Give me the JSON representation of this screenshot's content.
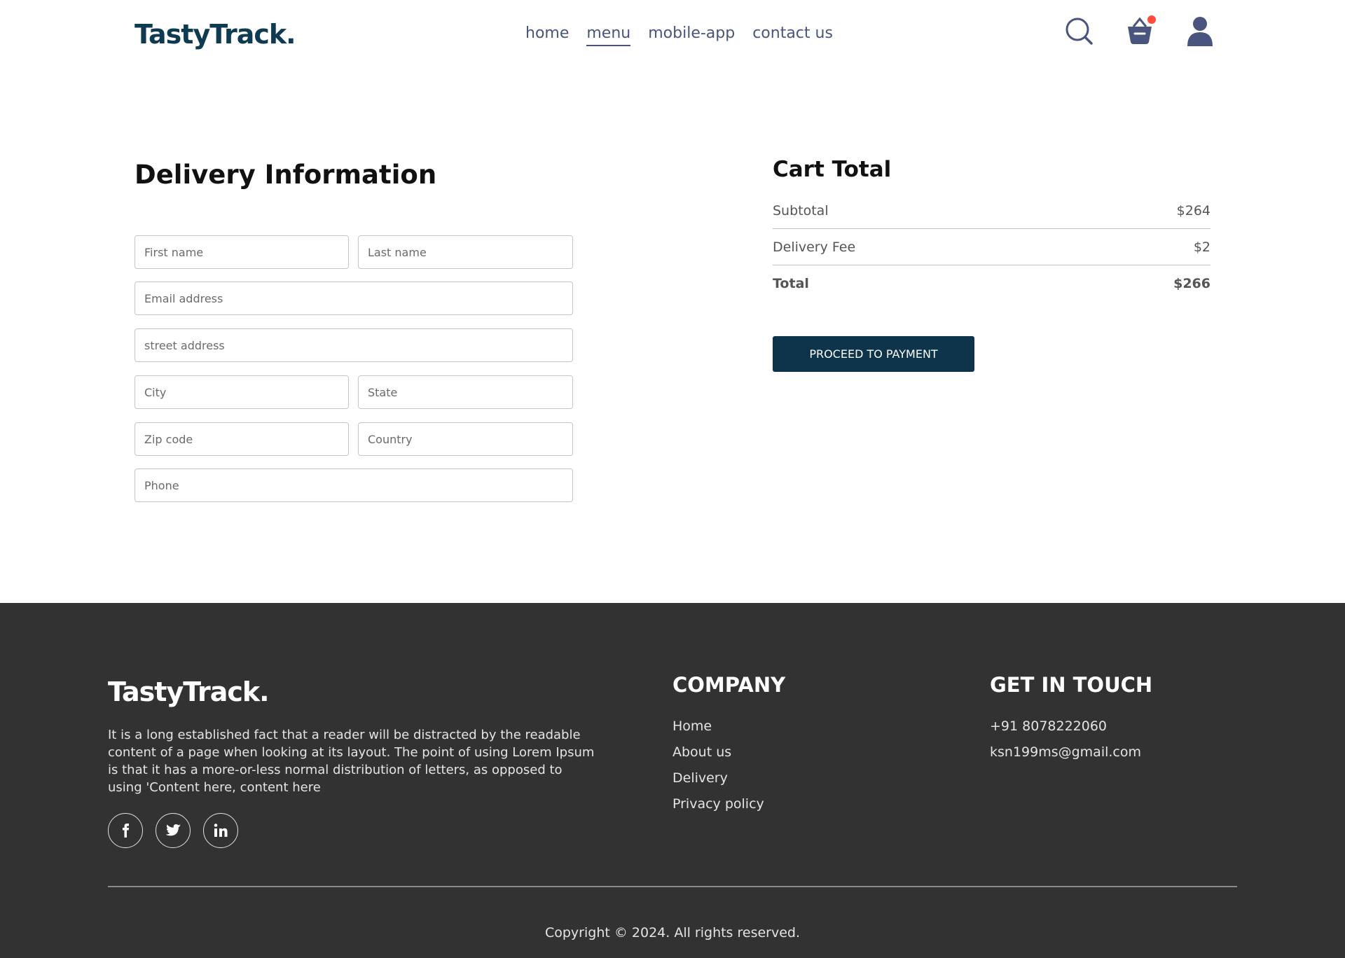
{
  "navbar": {
    "logo": "TastyTrack.",
    "menu": [
      "home",
      "menu",
      "mobile-app",
      "contact us"
    ],
    "active_menu": "menu",
    "icons": [
      "search-icon",
      "basket-icon",
      "profile-icon"
    ],
    "basket_badge_color": "#ff4d3d"
  },
  "delivery": {
    "title": "Delivery Information",
    "fields": {
      "first_name": "First name",
      "last_name": "Last name",
      "email": "Email address",
      "street": "street address",
      "city": "City",
      "state": "State",
      "zip": "Zip code",
      "country": "Country",
      "phone": "Phone"
    }
  },
  "cart": {
    "title": "Cart Total",
    "subtotal_label": "Subtotal",
    "subtotal_value": "$264",
    "fee_label": "Delivery Fee",
    "fee_value": "$2",
    "total_label": "Total",
    "total_value": "$266",
    "button": "PROCEED TO PAYMENT",
    "button_color": "#0d344b"
  },
  "footer": {
    "logo": "TastyTrack.",
    "description": "It is a long established fact that a reader will be distracted by the readable content of a page when looking at its layout. The point of using Lorem Ipsum is that it has a more-or-less normal distribution of letters, as opposed to using 'Content here, content here",
    "socials": [
      "facebook-icon",
      "twitter-icon",
      "linkedin-icon"
    ],
    "company_title": "COMPANY",
    "company_links": [
      "Home",
      "About us",
      "Delivery",
      "Privacy policy"
    ],
    "contact_title": "GET IN TOUCH",
    "phone": "+91 8078222060",
    "email": "ksn199ms@gmail.com",
    "copyright": "Copyright © 2024. All rights reserved.",
    "background": "#323232"
  }
}
